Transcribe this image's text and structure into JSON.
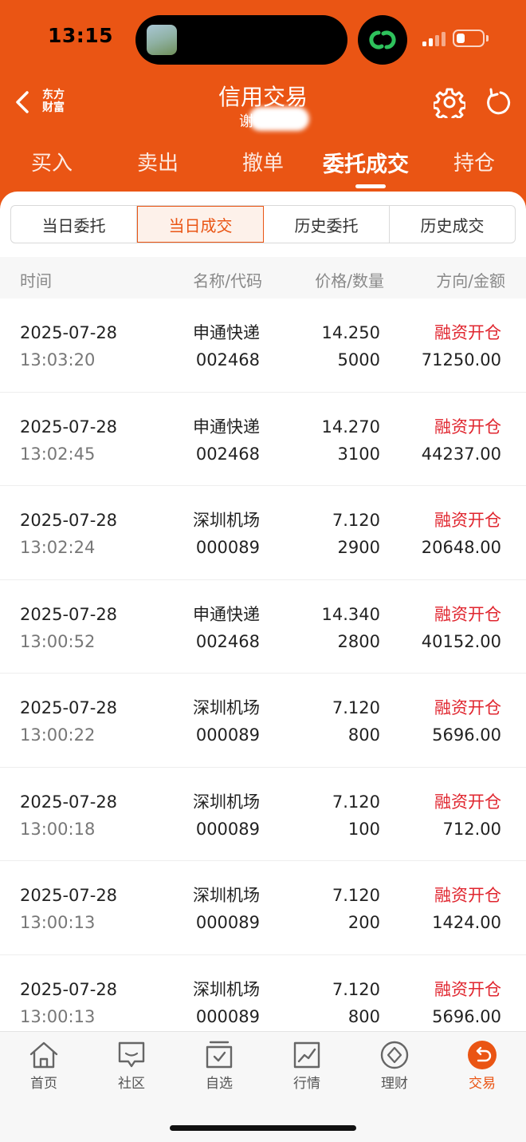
{
  "status_bar": {
    "time": "13:15"
  },
  "header": {
    "logo_line1": "东方",
    "logo_line2": "财富",
    "title": "信用交易",
    "subtitle": "谢"
  },
  "main_tabs": [
    {
      "label": "买入"
    },
    {
      "label": "卖出"
    },
    {
      "label": "撤单"
    },
    {
      "label": "委托成交",
      "active": true
    },
    {
      "label": "持仓"
    }
  ],
  "segments": [
    {
      "label": "当日委托"
    },
    {
      "label": "当日成交",
      "active": true
    },
    {
      "label": "历史委托"
    },
    {
      "label": "历史成交"
    }
  ],
  "table_headers": {
    "time": "时间",
    "name_code": "名称/代码",
    "price_qty": "价格/数量",
    "direction_amount": "方向/金额"
  },
  "rows": [
    {
      "date": "2025-07-28",
      "time": "13:03:20",
      "name": "申通快递",
      "code": "002468",
      "price": "14.250",
      "qty": "5000",
      "direction": "融资开仓",
      "amount": "71250.00"
    },
    {
      "date": "2025-07-28",
      "time": "13:02:45",
      "name": "申通快递",
      "code": "002468",
      "price": "14.270",
      "qty": "3100",
      "direction": "融资开仓",
      "amount": "44237.00"
    },
    {
      "date": "2025-07-28",
      "time": "13:02:24",
      "name": "深圳机场",
      "code": "000089",
      "price": "7.120",
      "qty": "2900",
      "direction": "融资开仓",
      "amount": "20648.00"
    },
    {
      "date": "2025-07-28",
      "time": "13:00:52",
      "name": "申通快递",
      "code": "002468",
      "price": "14.340",
      "qty": "2800",
      "direction": "融资开仓",
      "amount": "40152.00"
    },
    {
      "date": "2025-07-28",
      "time": "13:00:22",
      "name": "深圳机场",
      "code": "000089",
      "price": "7.120",
      "qty": "800",
      "direction": "融资开仓",
      "amount": "5696.00"
    },
    {
      "date": "2025-07-28",
      "time": "13:00:18",
      "name": "深圳机场",
      "code": "000089",
      "price": "7.120",
      "qty": "100",
      "direction": "融资开仓",
      "amount": "712.00"
    },
    {
      "date": "2025-07-28",
      "time": "13:00:13",
      "name": "深圳机场",
      "code": "000089",
      "price": "7.120",
      "qty": "200",
      "direction": "融资开仓",
      "amount": "1424.00"
    },
    {
      "date": "2025-07-28",
      "time": "13:00:13",
      "name": "深圳机场",
      "code": "000089",
      "price": "7.120",
      "qty": "800",
      "direction": "融资开仓",
      "amount": "5696.00"
    }
  ],
  "bottom_tabs": [
    {
      "label": "首页",
      "icon": "home-icon"
    },
    {
      "label": "社区",
      "icon": "chat-bubble-icon"
    },
    {
      "label": "自选",
      "icon": "watchlist-icon"
    },
    {
      "label": "行情",
      "icon": "market-chart-icon"
    },
    {
      "label": "理财",
      "icon": "diamond-icon"
    },
    {
      "label": "交易",
      "icon": "trade-icon",
      "active": true
    }
  ],
  "colors": {
    "brand": "#ea5514",
    "direction_text": "#e0262f",
    "wechat_green": "#2ec25c"
  }
}
